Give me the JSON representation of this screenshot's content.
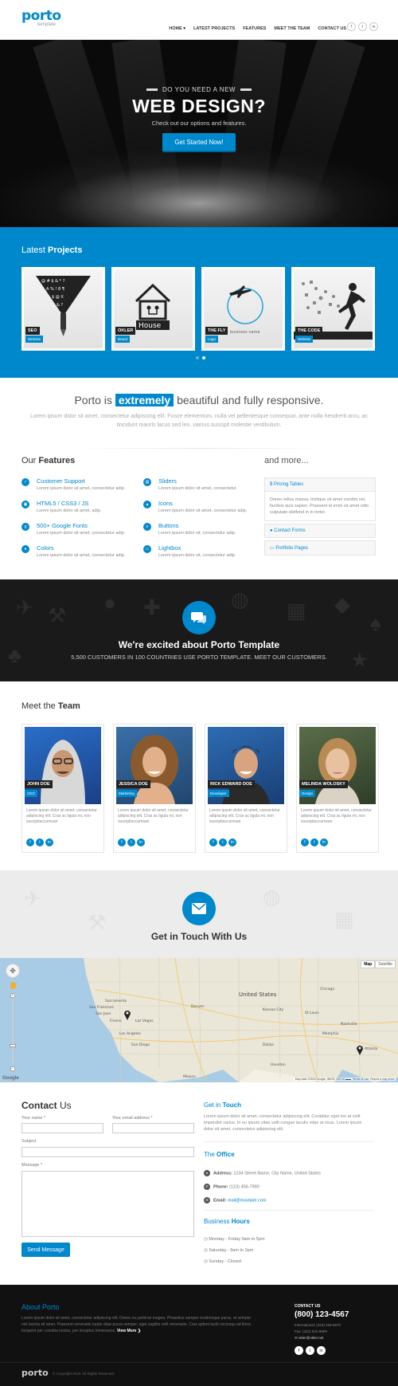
{
  "header": {
    "logo": "porto",
    "logo_sub": "template",
    "nav": [
      "HOME ▾",
      "LATEST PROJECTS",
      "FEATURES",
      "MEET THE TEAM",
      "CONTACT US"
    ],
    "social": [
      "f",
      "t",
      "in"
    ]
  },
  "hero": {
    "kicker": "DO YOU NEED A NEW",
    "title": "WEB DESIGN?",
    "subtitle": "Check out our options and features.",
    "cta": "Get Started Now!"
  },
  "projects": {
    "title_pre": "Latest",
    "title_bold": "Projects",
    "items": [
      {
        "label": "SEO",
        "tag": "Website"
      },
      {
        "label": "OKLER",
        "tag": "Brand"
      },
      {
        "label": "THE FLY",
        "tag": "Logo"
      },
      {
        "label": "THE CODE",
        "tag": "Website"
      }
    ],
    "house_text": "House",
    "business_text": "business name"
  },
  "intro": {
    "pre": "Porto is",
    "highlight": "extremely",
    "post": "beautiful and fully responsive.",
    "paragraph": "Lorem ipsum dolor sit amet, consectetur adipiscing elit. Fusce elementum, nulla vel pellentesque consequat, ante nulla hendrerit arcu, ac tincidunt mauris lacus sed leo. vamus suscipit molestie vestibulum."
  },
  "features": {
    "title_pre": "Our",
    "title_bold": "Features",
    "items": [
      {
        "title": "Customer Support",
        "desc": "Lorem ipsum dolor sit amet, consectetur adip."
      },
      {
        "title": "Sliders",
        "desc": "Lorem ipsum dolor sit amet, consectetur."
      },
      {
        "title": "HTML5 / CSS3 / JS",
        "desc": "Lorem ipsum dolor sit amet, adip."
      },
      {
        "title": "Icons",
        "desc": "Lorem ipsum dolor sit amet, consectetur adip."
      },
      {
        "title": "500+ Google Fonts",
        "desc": "Lorem ipsum dolor sit amet, consectetur adip."
      },
      {
        "title": "Buttons",
        "desc": "Lorem ipsum dolor sit, consectetur adip."
      },
      {
        "title": "Colors",
        "desc": "Lorem ipsum dolor sit amet, consectetur adip."
      },
      {
        "title": "Lightbox",
        "desc": "Lorem ipsum dolor sit, consectetur adip."
      }
    ],
    "more_title": "and more...",
    "accordion": [
      {
        "title": "Pricing Tables",
        "body": "Donec tellus massa, tristique sit amet condim vel, facilisis quis sapien. Praesent id enim sit amet odio vulputate eleifend in in tortor."
      },
      {
        "title": "Contact Forms"
      },
      {
        "title": "Portfolio Pages"
      }
    ]
  },
  "excited": {
    "title": "We're excited about Porto Template",
    "subtitle": "5,500 CUSTOMERS IN 100 COUNTRIES USE PORTO TEMPLATE. MEET OUR CUSTOMERS."
  },
  "team": {
    "title_pre": "Meet the",
    "title_bold": "Team",
    "members": [
      {
        "name": "JOHN DOE",
        "role": "CEO",
        "desc": "Lorem ipsum dolor sit amet, consectetur adipiscing elit. Cras ac ligula mi, non suscipitaccumsan"
      },
      {
        "name": "JESSICA DOE",
        "role": "Marketing",
        "desc": "Lorem ipsum dolor sit amet, consectetur adipiscing elit. Cras ac ligula mi, non suscipitaccumsan"
      },
      {
        "name": "RICK EDWARD DOE",
        "role": "Developer",
        "desc": "Lorem ipsum dolor sit amet, consectetur adipiscing elit. Cras ac ligula mi, non suscipitaccumsan"
      },
      {
        "name": "MELINDA WOLOSKY",
        "role": "Design",
        "desc": "Lorem ipsum dolor sit amet, consectetur adipiscing elit. Cras ac ligula mi, non suscipitaccumsan"
      }
    ]
  },
  "touch": {
    "title": "Get in Touch With Us"
  },
  "map": {
    "label": "United States",
    "map_btn": "Map",
    "sat_btn": "Satellite",
    "cities": [
      "Sacramento",
      "San Francisco",
      "San Jose",
      "Fresno",
      "Las Vegas",
      "Los Angeles",
      "San Diego",
      "Atlanta",
      "Nashville",
      "Memphis",
      "Dallas",
      "Houston",
      "Chicago",
      "Denver",
      "Kansas City",
      "St Louis",
      "Mexico"
    ],
    "attribution": "Map data ©2015 Google, INEGI",
    "scale": "200 mi",
    "terms": "Terms of Use",
    "report": "Report a map error",
    "google": "Google"
  },
  "contact": {
    "title_bold": "Contact",
    "title_rest": "Us",
    "name_label": "Your name *",
    "email_label": "Your email address *",
    "subject_label": "Subject",
    "message_label": "Message *",
    "send": "Send Message",
    "get_pre": "Get in",
    "get_bold": "Touch",
    "get_text": "Lorem ipsum dolor sit amet, consectetur adipiscing elit. Curabitur eget leo at velit imperdiet varius. In eu ipsum vitae velit congue iaculis vitae at risus. Lorem ipsum dolor sit amet, consectetur adipiscing elit.",
    "office_pre": "The",
    "office_bold": "Office",
    "address_label": "Address:",
    "address": "1234 Street Name, City Name, United States",
    "phone_label": "Phone:",
    "phone": "(123) 456-7890",
    "email_label2": "Email:",
    "email": "mail@example.com",
    "hours_pre": "Business",
    "hours_bold": "Hours",
    "hours": [
      "Monday - Friday 9am to 5pm",
      "Saturday - 9am to 2pm",
      "Sunday - Closed"
    ]
  },
  "footer": {
    "about": "About Porto",
    "text": "Lorem ipsum dolor sit amet, consectetur adipiscing elit. Donec eu pulvinar magna. Phasellus semper scelerisque purus, et semper nisl lacinia sit amet. Praesent venenatis turpis vitae purus semper, eget sagittis velit venenatis. Cras aptent taciti sociosqu ad litora torquent per conubia nostra, per inceptos himenaeos.",
    "view_more": "View More ❯",
    "contact_us": "CONTACT US",
    "phone": "(800) 123-4567",
    "international": "International: (333) 456-6670",
    "fax": "Fax: (222) 531-8999",
    "email": "okler@okler.net",
    "social": [
      "f",
      "t",
      "in"
    ],
    "logo": "porto",
    "copyright": "© Copyright 2015. All Rights Reserved."
  },
  "colors": {
    "accent": "#0088cc",
    "dark": "#1a1a1a",
    "footer": "#111111"
  }
}
